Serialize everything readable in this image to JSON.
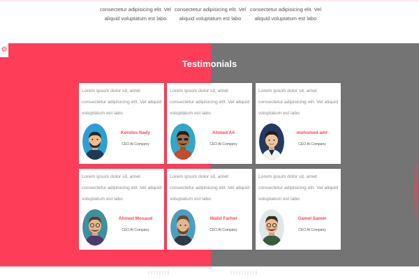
{
  "colors": {
    "accent": "#fe3d58",
    "gray_panel": "#747474",
    "card_bg": "#ffffff"
  },
  "features": [
    {
      "text": "consectetur adipisicing elit. Vel aliquid voluptatum est labo"
    },
    {
      "text": "consectetur adipisicing elit. Vel aliquid voluptatum est labo"
    },
    {
      "text": "consectetur adipisicing elit. Vel aliquid voluptatum est labo"
    }
  ],
  "settings": {
    "icon": "gear-icon",
    "glyph": "⚙"
  },
  "testimonials": {
    "title": "Testimonials",
    "items": [
      {
        "quote": "Lorem ipsum dolor sit, amet consectetur adipisicing elit. Vel aliquid voluptatum est labo",
        "name": "Kerolos Nady",
        "role": "CEO At Company"
      },
      {
        "quote": "Lorem ipsum dolor sit, amet consectetur adipisicing elit. Vel aliquid voluptatum est labo",
        "name": "Ahmed Ali",
        "role": "CEO At Company"
      },
      {
        "quote": "Lorem ipsum dolor sit, amet consectetur adipisicing elit. Vel aliquid voluptatum est labo",
        "name": "mohomed amr",
        "role": "CEO At Company"
      },
      {
        "quote": "Lorem ipsum dolor sit, amet consectetur adipisicing elit. Vel aliquid voluptatum est labo",
        "name": "Ahmed Mosaud",
        "role": "CEO At Company"
      },
      {
        "quote": "Lorem ipsum dolor sit, amet consectetur adipisicing elit. Vel aliquid voluptatum est labo",
        "name": "Walid Farhet",
        "role": "CEO At Company"
      },
      {
        "quote": "Lorem ipsum dolor sit, amet consectetur adipisicing elit. Vel aliquid voluptatum est labo",
        "name": "Gamel Samer",
        "role": "CEO At Company"
      }
    ]
  }
}
